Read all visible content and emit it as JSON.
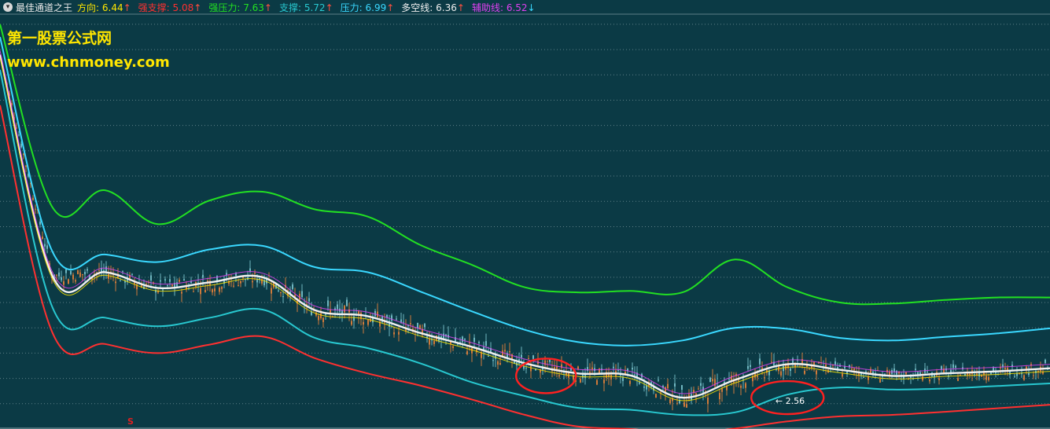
{
  "header": {
    "collapse_icon": "chevron-down-icon",
    "title": "最佳通道之王",
    "indicators": [
      {
        "label": "方向:",
        "value": "6.44",
        "arrow": "↑",
        "color": "#ffe600"
      },
      {
        "label": "强支撑:",
        "value": "5.08",
        "arrow": "↑",
        "color": "#ff3030"
      },
      {
        "label": "强压力:",
        "value": "7.63",
        "arrow": "↑",
        "color": "#22e022"
      },
      {
        "label": "支撑:",
        "value": "5.72",
        "arrow": "↑",
        "color": "#28c8d0"
      },
      {
        "label": "压力:",
        "value": "6.99",
        "arrow": "↑",
        "color": "#3ad8ff"
      },
      {
        "label": "多空线:",
        "value": "6.36",
        "arrow": "↑",
        "color": "#f0f0f0"
      },
      {
        "label": "辅助线:",
        "value": "6.52",
        "arrow": "↓",
        "color": "#e040f0"
      }
    ]
  },
  "watermark": {
    "line1": "第一股票公式网",
    "line2": "www.chnmoney.com"
  },
  "marker": {
    "text": "S",
    "color": "#e02020"
  },
  "annotation": {
    "text": "← 2.56"
  },
  "colors": {
    "background": "#0b3a45",
    "grid": "#5d7f86",
    "up_candle": "#d07a3a",
    "down_candle": "#6fb6c0",
    "ellipse": "#ff2020"
  },
  "chart_data": {
    "type": "line",
    "x": [
      0,
      5,
      10,
      15,
      20,
      25,
      30,
      35,
      40,
      45,
      50,
      55,
      60,
      65,
      70,
      75,
      80,
      85,
      90,
      95,
      100
    ],
    "ylim": [
      2.0,
      10.2
    ],
    "grid": "dotted horizontal",
    "series": [
      {
        "key": "强压力",
        "color": "#22e022",
        "values": [
          10.0,
          6.38,
          6.72,
          6.05,
          6.52,
          6.69,
          6.34,
          6.2,
          5.64,
          5.24,
          4.8,
          4.7,
          4.73,
          4.7,
          5.35,
          4.8,
          4.5,
          4.48,
          4.55,
          4.6,
          4.6
        ]
      },
      {
        "key": "压力",
        "color": "#3ad8ff",
        "values": [
          9.75,
          5.5,
          5.45,
          5.3,
          5.55,
          5.62,
          5.2,
          5.1,
          4.72,
          4.32,
          3.96,
          3.72,
          3.65,
          3.75,
          4.0,
          3.98,
          3.8,
          3.75,
          3.82,
          3.89,
          3.99
        ]
      },
      {
        "key": "多空线",
        "color": "#f0f0f0",
        "values": [
          9.4,
          5.02,
          5.1,
          4.79,
          4.9,
          5.0,
          4.35,
          4.23,
          3.9,
          3.62,
          3.3,
          3.1,
          3.06,
          2.62,
          2.97,
          3.28,
          3.17,
          3.05,
          3.1,
          3.14,
          3.2
        ]
      },
      {
        "key": "支撑",
        "color": "#28c8d0",
        "values": [
          9.1,
          4.4,
          4.2,
          4.03,
          4.2,
          4.36,
          3.8,
          3.6,
          3.3,
          2.92,
          2.65,
          2.42,
          2.38,
          2.28,
          2.33,
          2.68,
          2.82,
          2.78,
          2.8,
          2.85,
          2.9
        ]
      },
      {
        "key": "强支撑",
        "color": "#ff3030",
        "values": [
          8.4,
          3.9,
          3.68,
          3.5,
          3.67,
          3.83,
          3.4,
          3.1,
          2.86,
          2.58,
          2.28,
          2.05,
          2.0,
          1.91,
          2.01,
          2.15,
          2.25,
          2.28,
          2.34,
          2.41,
          2.48
        ]
      }
    ],
    "annotations": [
      {
        "text": "← 2.56",
        "x": 74,
        "y": 2.56
      }
    ]
  }
}
